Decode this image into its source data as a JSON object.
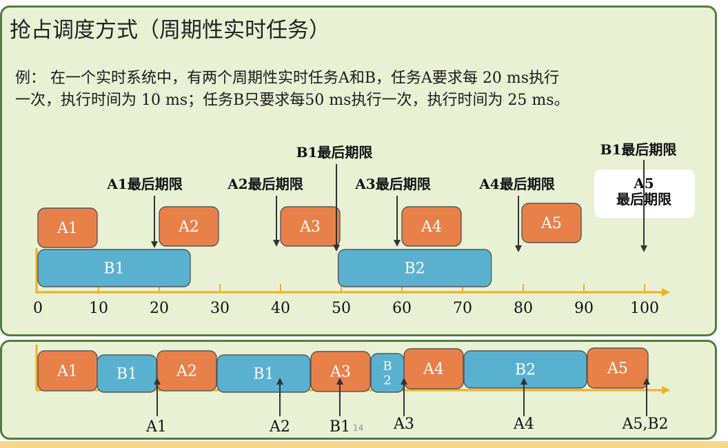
{
  "title": "抢占调度方式（周期性实时任务）",
  "example": {
    "line1": "例：  在一个实时系统中，有两个周期性实时任务A和B，任务A要求每 20 ms执行",
    "line2": "一次，执行时间为 10 ms；任务B只要求每50 ms执行一次，执行时间为 25 ms。"
  },
  "colors": {
    "task_a": "#e8804a",
    "task_b": "#5ab1cf",
    "axis": "#f2b01e",
    "panel_bg": "#e9f1d5",
    "panel_border": "#4f7f3e"
  },
  "top_axis_ticks": [
    "0",
    "10",
    "20",
    "30",
    "40",
    "50",
    "60",
    "70",
    "80",
    "90",
    "100"
  ],
  "top_blocks": [
    "A1",
    "A2",
    "A3",
    "A4",
    "A5",
    "B1",
    "B2"
  ],
  "deadlines": [
    "A1最后期限",
    "A2最后期限",
    "A3最后期限",
    "A4最后期限",
    "B1最后期限",
    "B1最后期限"
  ],
  "a5_deadline": "A5\n最后期限",
  "bottom_blocks": [
    "A1",
    "B1",
    "A2",
    "B1",
    "A3",
    "B\n2",
    "A4",
    "B2",
    "A5"
  ],
  "bottom_markers": [
    "A1",
    "A2",
    "B1",
    "A3",
    "A4",
    "A5,B2"
  ],
  "page_number": "14"
}
